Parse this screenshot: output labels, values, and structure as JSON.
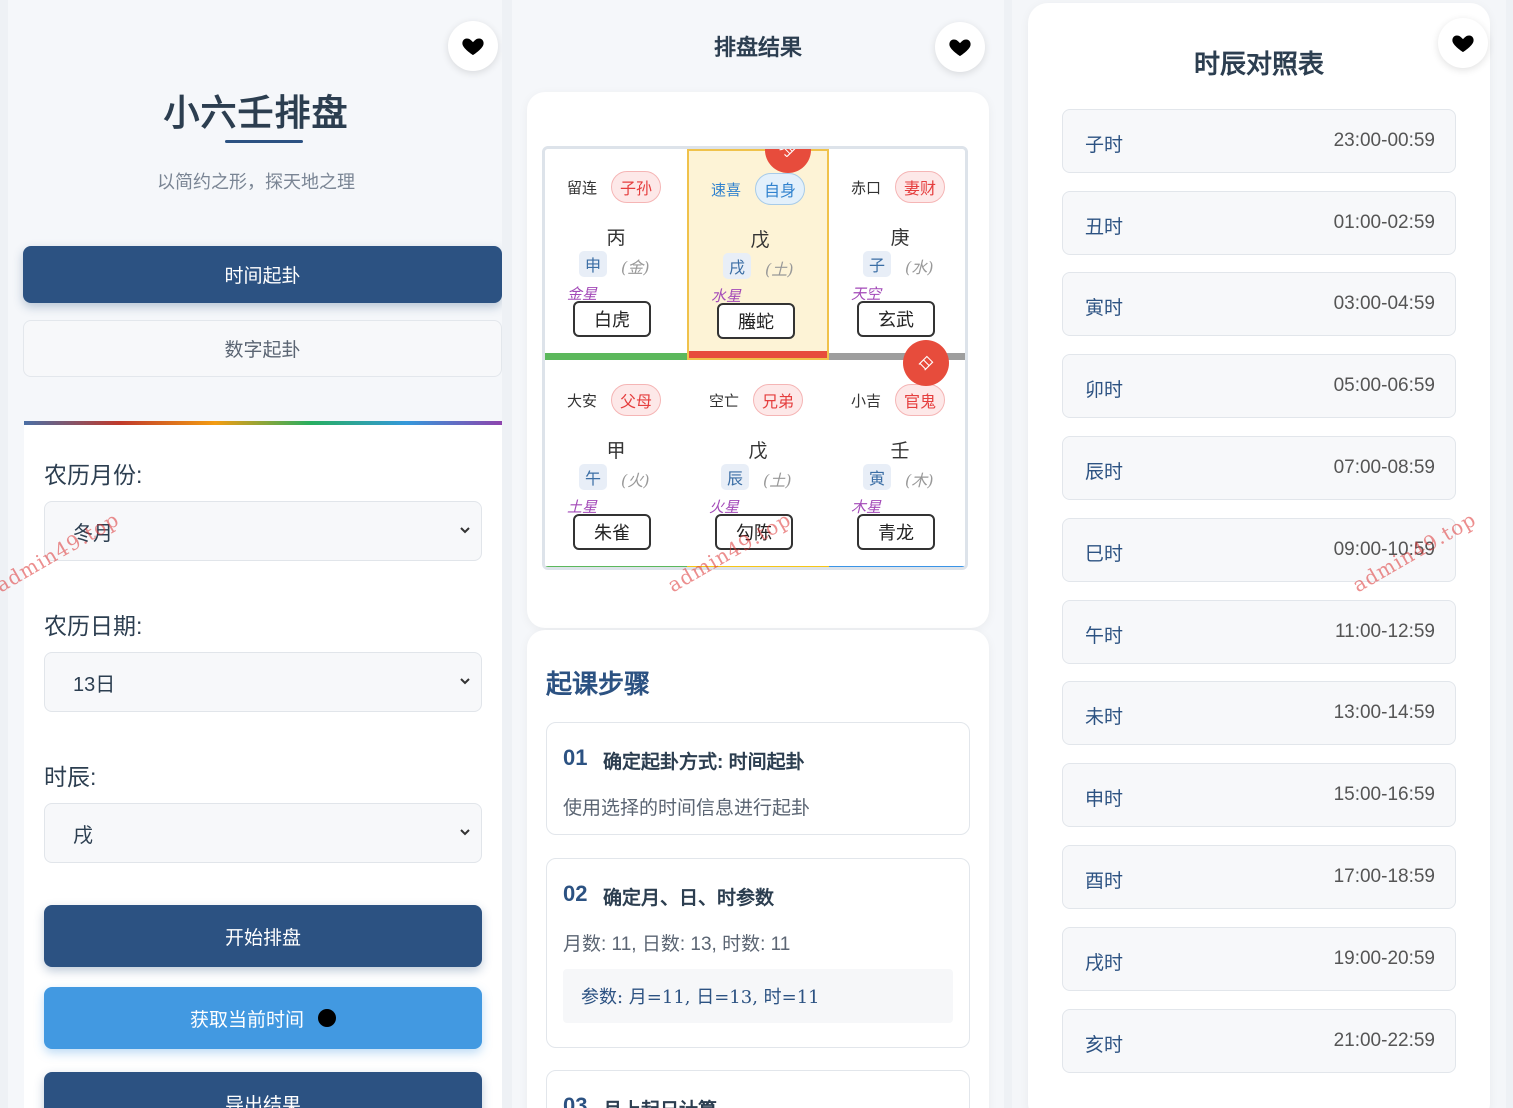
{
  "left": {
    "title": "小六壬排盘",
    "subtitle": "以简约之形，探天地之理",
    "mode_tabs": [
      "时间起卦",
      "数字起卦"
    ],
    "form": {
      "month_label": "农历月份:",
      "month_value": "冬月",
      "day_label": "农历日期:",
      "day_value": "13日",
      "hour_label": "时辰:",
      "hour_value": "戌"
    },
    "buttons": {
      "start": "开始排盘",
      "now": "获取当前时间",
      "export": "导出结果"
    }
  },
  "middle": {
    "title": "排盘结果",
    "cells": [
      {
        "palace": "留连",
        "relation": "子孙",
        "stem": "丙",
        "branch": "申",
        "element": "(金)",
        "star": "金星",
        "god": "白虎",
        "bar_color": "#5cb85c"
      },
      {
        "palace": "速喜",
        "relation": "自身",
        "stem": "戊",
        "branch": "戌",
        "element": "(土)",
        "star": "水星",
        "god": "螣蛇",
        "bar_color": "#e74c3c",
        "ribbon": "月"
      },
      {
        "palace": "赤口",
        "relation": "妻财",
        "stem": "庚",
        "branch": "子",
        "element": "(水)",
        "star": "天空",
        "god": "玄武",
        "bar_color": "#9e9e9e"
      },
      {
        "palace": "大安",
        "relation": "父母",
        "stem": "甲",
        "branch": "午",
        "element": "(火)",
        "star": "土星",
        "god": "朱雀",
        "bar_color": "#5cb85c"
      },
      {
        "palace": "空亡",
        "relation": "兄弟",
        "stem": "戊",
        "branch": "辰",
        "element": "(土)",
        "star": "火星",
        "god": "勾陈",
        "bar_color": "#f5c518"
      },
      {
        "palace": "小吉",
        "relation": "官鬼",
        "stem": "壬",
        "branch": "寅",
        "element": "(木)",
        "star": "木星",
        "god": "青龙",
        "bar_color": "#3b94e6",
        "ribbon": "日"
      }
    ],
    "steps_title": "起课步骤",
    "steps": [
      {
        "num": "01",
        "title": "确定起卦方式: 时间起卦",
        "desc": "使用选择的时间信息进行起卦"
      },
      {
        "num": "02",
        "title": "确定月、日、时参数",
        "desc": "月数: 11, 日数: 13, 时数: 11",
        "param": "参数: 月=11, 日=13, 时=11"
      },
      {
        "num": "03",
        "title": "月上起日计算"
      }
    ]
  },
  "right": {
    "title": "时辰对照表",
    "rows": [
      {
        "name": "子时",
        "time": "23:00-00:59"
      },
      {
        "name": "丑时",
        "time": "01:00-02:59"
      },
      {
        "name": "寅时",
        "time": "03:00-04:59"
      },
      {
        "name": "卯时",
        "time": "05:00-06:59"
      },
      {
        "name": "辰时",
        "time": "07:00-08:59"
      },
      {
        "name": "巳时",
        "time": "09:00-10:59"
      },
      {
        "name": "午时",
        "time": "11:00-12:59"
      },
      {
        "name": "未时",
        "time": "13:00-14:59"
      },
      {
        "name": "申时",
        "time": "15:00-16:59"
      },
      {
        "name": "酉时",
        "time": "17:00-18:59"
      },
      {
        "name": "戌时",
        "time": "19:00-20:59"
      },
      {
        "name": "亥时",
        "time": "21:00-22:59"
      }
    ]
  },
  "watermark": "admin49.top",
  "colors": {
    "primary": "#2c5282",
    "accent": "#4299e1",
    "danger": "#e74c3c"
  },
  "icons": [
    "heart-icon",
    "chevron-down-icon"
  ]
}
